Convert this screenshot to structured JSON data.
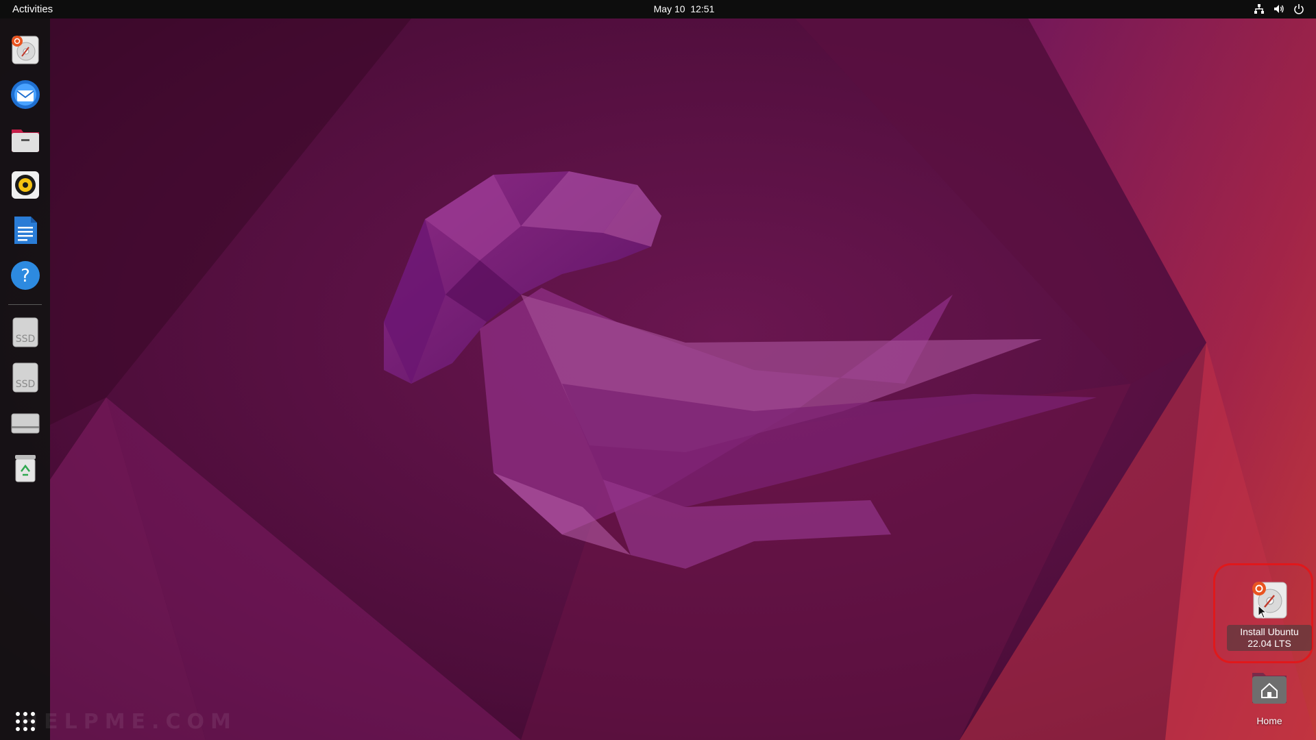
{
  "topbar": {
    "activities_label": "Activities",
    "date": "May 10",
    "time": "12:51",
    "status_icons": [
      "network-icon",
      "volume-icon",
      "power-icon"
    ]
  },
  "dock": {
    "items": [
      {
        "name": "Install Ubuntu 22.04 LTS",
        "icon": "ubiquity-installer-icon"
      },
      {
        "name": "Thunderbird Mail",
        "icon": "thunderbird-icon"
      },
      {
        "name": "Files",
        "icon": "files-icon"
      },
      {
        "name": "Rhythmbox",
        "icon": "rhythmbox-icon"
      },
      {
        "name": "LibreOffice Writer",
        "icon": "writer-icon"
      },
      {
        "name": "Help",
        "icon": "help-icon"
      },
      {
        "name": "SSD Drive 1",
        "icon": "ssd-icon",
        "label": "SSD"
      },
      {
        "name": "SSD Drive 2",
        "icon": "ssd-icon",
        "label": "SSD"
      },
      {
        "name": "Drive",
        "icon": "drive-icon"
      },
      {
        "name": "Trash",
        "icon": "trash-icon"
      }
    ],
    "show_apps_icon": "app-grid-icon"
  },
  "desktop": {
    "install": {
      "label_line1": "Install Ubuntu",
      "label_line2": "22.04 LTS",
      "icon": "ubiquity-installer-icon"
    },
    "home": {
      "label": "Home",
      "icon": "home-folder-icon"
    }
  },
  "watermark": "HELPME.COM",
  "colors": {
    "topbar": "#0d0d0d",
    "dock": "#121212",
    "wallpaper_dark": "#3d0a2d",
    "wallpaper_mid": "#7a1a55",
    "wallpaper_warm": "#c0303f",
    "highlight": "#e0181b"
  }
}
